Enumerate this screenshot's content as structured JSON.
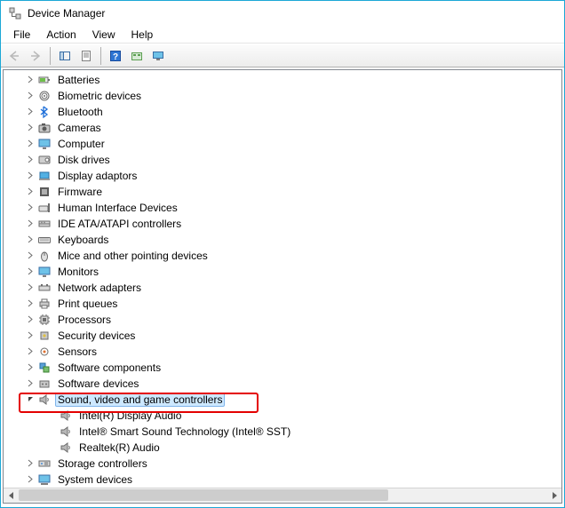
{
  "window": {
    "title": "Device Manager"
  },
  "menubar": {
    "file": "File",
    "action": "Action",
    "view": "View",
    "help": "Help"
  },
  "tree": {
    "batteries": "Batteries",
    "biometric": "Biometric devices",
    "bluetooth": "Bluetooth",
    "cameras": "Cameras",
    "computer": "Computer",
    "disk": "Disk drives",
    "display": "Display adaptors",
    "firmware": "Firmware",
    "hid": "Human Interface Devices",
    "ide": "IDE ATA/ATAPI controllers",
    "keyboards": "Keyboards",
    "mice": "Mice and other pointing devices",
    "monitors": "Monitors",
    "network": "Network adapters",
    "printq": "Print queues",
    "processors": "Processors",
    "security": "Security devices",
    "sensors": "Sensors",
    "swcomp": "Software components",
    "swdev": "Software devices",
    "sound": "Sound, video and game controllers",
    "sound_children": {
      "intel_display": "Intel(R) Display Audio",
      "intel_sst": "Intel® Smart Sound Technology (Intel® SST)",
      "realtek": "Realtek(R) Audio"
    },
    "storage": "Storage controllers",
    "system": "System devices"
  }
}
